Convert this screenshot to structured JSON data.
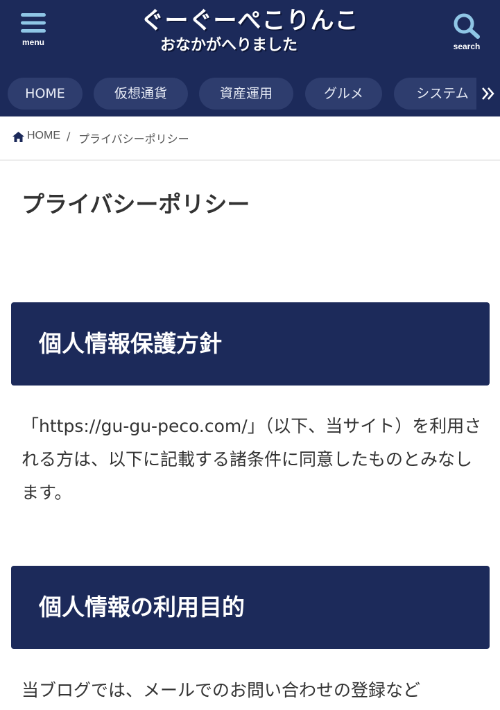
{
  "header": {
    "menu_label": "menu",
    "search_label": "search",
    "logo_line1": "ぐーぐーぺこりんこ",
    "logo_line2": "おなかがへりました",
    "bg_color": "#1c2a5a"
  },
  "nav": {
    "items": [
      {
        "label": "HOME"
      },
      {
        "label": "仮想通貨"
      },
      {
        "label": "資産運用"
      },
      {
        "label": "グルメ"
      },
      {
        "label": "システム"
      }
    ],
    "more_icon": "double-chevron-right-icon"
  },
  "breadcrumb": {
    "home_icon": "home-icon",
    "home_label": "HOME",
    "separator": "/",
    "current": "プライバシーポリシー"
  },
  "page": {
    "title": "プライバシーポリシー",
    "sections": [
      {
        "heading": "個人情報保護方針",
        "text": "「https://gu-gu-peco.com/」（以下、当サイト）を利用される方は、以下に記載する諸条件に同意したものとみなします。"
      },
      {
        "heading": "個人情報の利用目的",
        "text": "当ブログでは、メールでのお問い合わせの登録など"
      }
    ]
  }
}
